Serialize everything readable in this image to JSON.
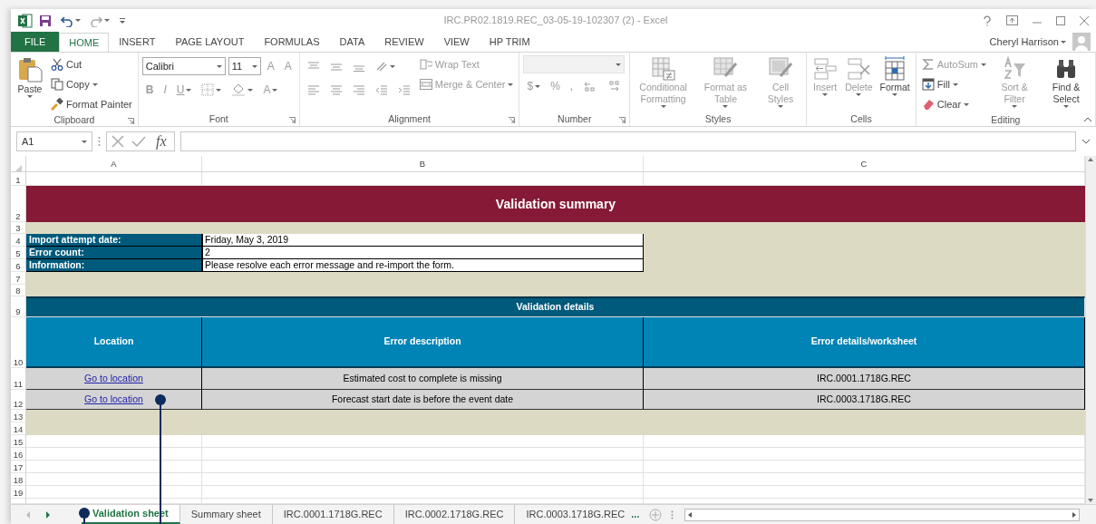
{
  "window": {
    "title": "IRC.PR02.1819.REC_03-05-19-102307 (2) - Excel",
    "user": "Cheryl Harrison"
  },
  "ribbon_tabs": [
    {
      "label": "FILE",
      "kind": "file",
      "selected": false
    },
    {
      "label": "HOME",
      "kind": "tab",
      "selected": true
    },
    {
      "label": "INSERT",
      "kind": "tab",
      "selected": false
    },
    {
      "label": "PAGE LAYOUT",
      "kind": "tab",
      "selected": false
    },
    {
      "label": "FORMULAS",
      "kind": "tab",
      "selected": false
    },
    {
      "label": "DATA",
      "kind": "tab",
      "selected": false
    },
    {
      "label": "REVIEW",
      "kind": "tab",
      "selected": false
    },
    {
      "label": "VIEW",
      "kind": "tab",
      "selected": false
    },
    {
      "label": "HP TRIM",
      "kind": "tab",
      "selected": false
    }
  ],
  "ribbon_groups": [
    {
      "label": "Clipboard",
      "launcher": true,
      "columns": [
        [
          {
            "kind": "large",
            "label": "Paste",
            "dropdown": true,
            "disabled": false
          }
        ],
        [
          {
            "kind": "small",
            "label": "Cut",
            "dropdown": false,
            "disabled": false
          },
          {
            "kind": "small",
            "label": "Copy",
            "dropdown": true,
            "disabled": false
          },
          {
            "kind": "small",
            "label": "Format Painter",
            "dropdown": false,
            "disabled": false
          }
        ]
      ]
    },
    {
      "label": "Font",
      "launcher": true,
      "columns": [
        [
          {
            "kind": "row",
            "items": [
              {
                "kind": "combo",
                "value": "Calibri",
                "wide": true
              },
              {
                "kind": "combo",
                "value": "11",
                "wide": false
              },
              {
                "kind": "glyph",
                "label": "A",
                "dropdown": false,
                "disabled": true
              },
              {
                "kind": "glyph",
                "label": "A",
                "dropdown": false,
                "disabled": true
              }
            ]
          },
          {
            "kind": "row",
            "items": [
              {
                "kind": "glyph",
                "label": "B",
                "dropdown": false,
                "disabled": true
              },
              {
                "kind": "glyph",
                "label": "I",
                "dropdown": false,
                "disabled": true
              },
              {
                "kind": "glyph",
                "label": "U",
                "dropdown": true,
                "disabled": true
              },
              {
                "kind": "icon",
                "dropdown": true,
                "disabled": true
              },
              {
                "kind": "icon",
                "dropdown": true,
                "disabled": true
              },
              {
                "kind": "glyph",
                "label": "A",
                "dropdown": true,
                "disabled": true
              }
            ]
          }
        ]
      ]
    },
    {
      "label": "Alignment",
      "launcher": true,
      "columns": [
        [
          {
            "kind": "row",
            "items": [
              {
                "kind": "icon",
                "dropdown": false,
                "disabled": true
              },
              {
                "kind": "icon",
                "dropdown": false,
                "disabled": true
              },
              {
                "kind": "icon",
                "dropdown": false,
                "disabled": true
              },
              {
                "kind": "icon",
                "dropdown": true,
                "disabled": true
              }
            ]
          },
          {
            "kind": "row",
            "items": [
              {
                "kind": "icon",
                "dropdown": false,
                "disabled": true
              },
              {
                "kind": "icon",
                "dropdown": false,
                "disabled": true
              },
              {
                "kind": "icon",
                "dropdown": false,
                "disabled": true
              },
              {
                "kind": "icon",
                "dropdown": false,
                "disabled": true
              },
              {
                "kind": "icon",
                "dropdown": false,
                "disabled": true
              }
            ]
          }
        ],
        [
          {
            "kind": "small",
            "label": "Wrap Text",
            "dropdown": false,
            "disabled": true
          },
          {
            "kind": "small",
            "label": "Merge & Center",
            "dropdown": true,
            "disabled": true
          }
        ]
      ]
    },
    {
      "label": "Number",
      "launcher": true,
      "columns": [
        [
          {
            "kind": "combo",
            "wide": true,
            "disabled": true
          },
          {
            "kind": "row",
            "items": [
              {
                "kind": "glyph",
                "label": "$",
                "dropdown": true,
                "disabled": true
              },
              {
                "kind": "glyph",
                "label": "%",
                "dropdown": false,
                "disabled": true
              },
              {
                "kind": "glyph",
                "label": ",",
                "dropdown": false,
                "disabled": true
              },
              {
                "kind": "icon",
                "dropdown": false,
                "disabled": true
              },
              {
                "kind": "icon",
                "dropdown": false,
                "disabled": true
              }
            ]
          }
        ]
      ]
    },
    {
      "label": "Styles",
      "launcher": false,
      "columns": [
        [
          {
            "kind": "large",
            "label": "Conditional Formatting",
            "dropdown": true,
            "disabled": true
          }
        ],
        [
          {
            "kind": "large",
            "label": "Format as Table",
            "dropdown": true,
            "disabled": true
          }
        ],
        [
          {
            "kind": "large",
            "label": "Cell Styles",
            "dropdown": true,
            "disabled": true
          }
        ]
      ]
    },
    {
      "label": "Cells",
      "launcher": false,
      "columns": [
        [
          {
            "kind": "large",
            "label": "Insert",
            "dropdown": true,
            "disabled": true
          }
        ],
        [
          {
            "kind": "large",
            "label": "Delete",
            "dropdown": true,
            "disabled": true
          }
        ],
        [
          {
            "kind": "large",
            "label": "Format",
            "dropdown": true,
            "disabled": false
          }
        ]
      ]
    },
    {
      "label": "Editing",
      "launcher": false,
      "columns": [
        [
          {
            "kind": "small",
            "label": "AutoSum",
            "dropdown": true,
            "disabled": true
          },
          {
            "kind": "small",
            "label": "Fill",
            "dropdown": true,
            "disabled": false
          },
          {
            "kind": "small",
            "label": "Clear",
            "dropdown": true,
            "disabled": false
          }
        ],
        [
          {
            "kind": "large",
            "label": "Sort & Filter",
            "dropdown": true,
            "disabled": true
          }
        ],
        [
          {
            "kind": "large",
            "label": "Find & Select",
            "dropdown": true,
            "disabled": false
          }
        ]
      ]
    }
  ],
  "formula_bar": {
    "name_box": "A1",
    "function_label": "fx"
  },
  "sheet": {
    "columns": [
      "A",
      "B",
      "C"
    ],
    "row_numbers": [
      "1",
      "2",
      "3",
      "4",
      "5",
      "6",
      "7",
      "8",
      "9",
      "10",
      "11",
      "12",
      "13",
      "14",
      "15",
      "16",
      "17",
      "18",
      "19"
    ],
    "title": "Validation summary",
    "info": [
      {
        "label": "Import attempt date:",
        "value": "Friday, May 3, 2019"
      },
      {
        "label": "Error count:",
        "value": "2"
      },
      {
        "label": "Information:",
        "value": "Please resolve each error message and re-import the form."
      }
    ],
    "details_title": "Validation details",
    "details_columns": [
      "Location",
      "Error description",
      "Error details/worksheet"
    ],
    "details_rows": [
      {
        "location": "Go to location",
        "description": "Estimated cost to complete is missing",
        "worksheet": "IRC.0001.1718G.REC"
      },
      {
        "location": "Go to location",
        "description": "Forecast start date is before the event date",
        "worksheet": "IRC.0003.1718G.REC"
      }
    ]
  },
  "sheet_tabs": [
    {
      "label": "Validation sheet",
      "selected": true
    },
    {
      "label": "Summary sheet",
      "selected": false
    },
    {
      "label": "IRC.0001.1718G.REC",
      "selected": false
    },
    {
      "label": "IRC.0002.1718G.REC",
      "selected": false
    },
    {
      "label": "IRC.0003.1718G.REC",
      "selected": false
    }
  ],
  "more_tabs": "..."
}
